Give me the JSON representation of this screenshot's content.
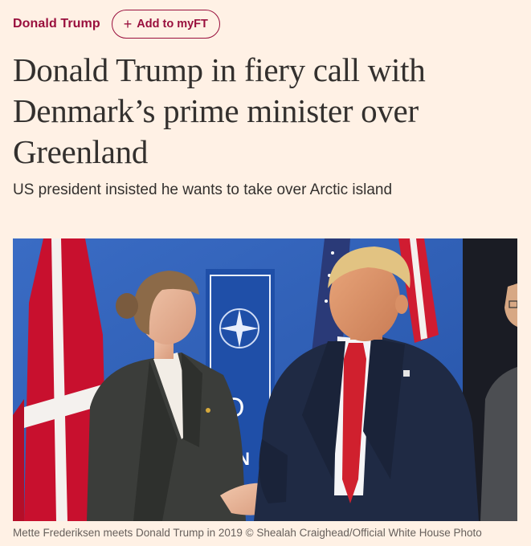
{
  "topic": {
    "label": "Donald Trump"
  },
  "myft": {
    "label": "Add to myFT",
    "icon": "plus-icon"
  },
  "article": {
    "headline": "Donald Trump in fiery call with Denmark’s prime minister over Greenland",
    "standfirst": "US president insisted he wants to take over Arctic island",
    "image": {
      "caption": "Mette Frederiksen meets Donald Trump in 2019 © Shealah Craighead/Official White House Photo",
      "backdrop_letters": [
        "O",
        "ON"
      ]
    }
  },
  "colors": {
    "background": "#fff1e5",
    "accent": "#990f3d",
    "text": "#33302e",
    "caption": "#66605c"
  }
}
